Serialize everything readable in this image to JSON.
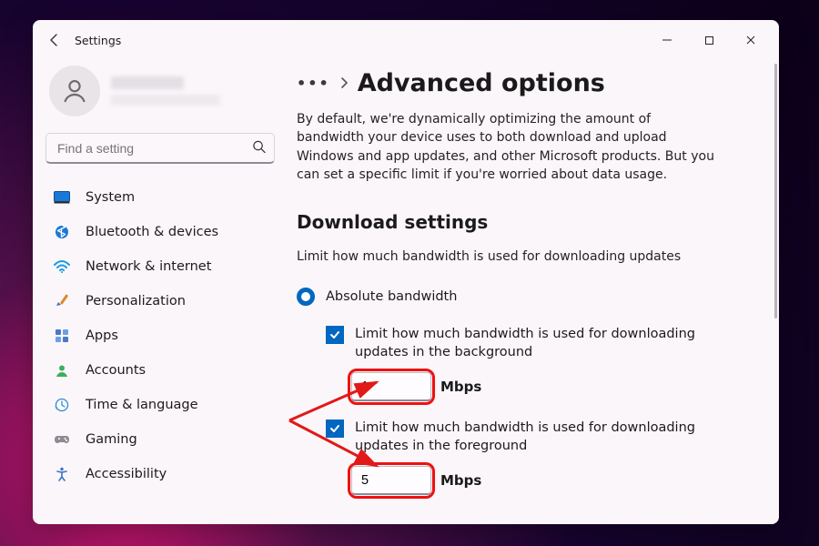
{
  "app": {
    "title": "Settings"
  },
  "search": {
    "placeholder": "Find a setting"
  },
  "nav": {
    "system": "System",
    "bluetooth": "Bluetooth & devices",
    "network": "Network & internet",
    "personalization": "Personalization",
    "apps": "Apps",
    "accounts": "Accounts",
    "time": "Time & language",
    "gaming": "Gaming",
    "accessibility": "Accessibility"
  },
  "breadcrumb": {
    "ellipsis": "…"
  },
  "page": {
    "title": "Advanced options",
    "description": "By default, we're dynamically optimizing the amount of bandwidth your device uses to both download and upload Windows and app updates, and other Microsoft products. But you can set a specific limit if you're worried about data usage."
  },
  "download": {
    "section_title": "Download settings",
    "section_sub": "Limit how much bandwidth is used for downloading updates",
    "radio_absolute": "Absolute bandwidth",
    "bg_chk_label": "Limit how much bandwidth is used for downloading updates in the background",
    "bg_value": "1",
    "fg_chk_label": "Limit how much bandwidth is used for downloading updates in the foreground",
    "fg_value": "5",
    "unit": "Mbps",
    "bg_checked": true,
    "fg_checked": true
  },
  "colors": {
    "accent": "#0067c0",
    "annotation": "#e11919"
  }
}
